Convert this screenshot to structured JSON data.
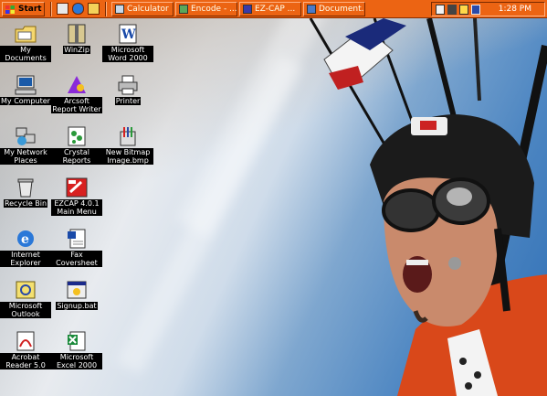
{
  "taskbar": {
    "start_label": "Start",
    "quick_launch": [
      "desktop-icon",
      "ie-icon",
      "outlook-icon"
    ],
    "tasks": [
      {
        "label": "Calculator",
        "color": "#3a6ea5"
      },
      {
        "label": "Encode - ...",
        "color": "#3a8a3a"
      },
      {
        "label": "EZ-CAP ...",
        "color": "#2a2a9a"
      },
      {
        "label": "Document...",
        "color": "#2a5aa0"
      }
    ],
    "tray_icons": [
      "volume-icon",
      "network-icon",
      "task-scheduler-icon",
      "monitor-icon"
    ],
    "clock": "1:28 PM",
    "color": "#ec6413"
  },
  "desktop": {
    "icons": [
      {
        "label": "My Documents"
      },
      {
        "label": "WinZip"
      },
      {
        "label": "Microsoft Word 2000"
      },
      {
        "label": "My Computer"
      },
      {
        "label": "Arcsoft Report Writer"
      },
      {
        "label": "Printer"
      },
      {
        "label": "My Network Places"
      },
      {
        "label": "Crystal Reports"
      },
      {
        "label": "New Bitmap Image.bmp"
      },
      {
        "label": "Recycle Bin"
      },
      {
        "label": "EZCAP 4.0.1 Main Menu"
      },
      {
        "label": "Internet Explorer"
      },
      {
        "label": "Fax Coversheet"
      },
      {
        "label": "Microsoft Outlook"
      },
      {
        "label": "Signup.bat"
      },
      {
        "label": "Acrobat Reader 5.0"
      },
      {
        "label": "Microsoft Excel 2000"
      }
    ]
  }
}
